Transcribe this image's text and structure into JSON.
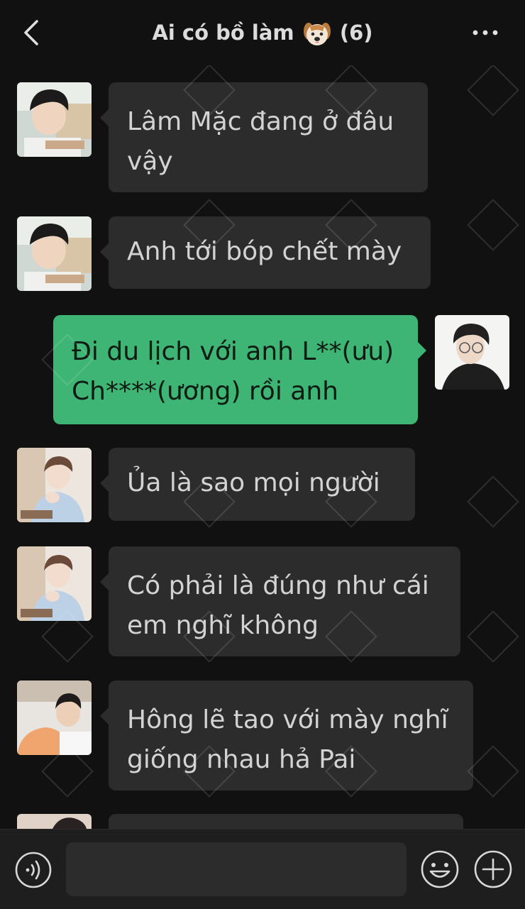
{
  "header": {
    "back_icon": "chevron-left-icon",
    "title_text": "Ai có bồ làm",
    "title_emoji": "dog-face-emoji",
    "member_count": "(6)",
    "more_icon": "ellipsis-icon"
  },
  "messages": [
    {
      "direction": "incoming",
      "avatar": "avatar-boy-reading",
      "text_lines": [
        "Lâm Mặc đang ở đâu",
        "vậy"
      ]
    },
    {
      "direction": "incoming",
      "avatar": "avatar-boy-reading",
      "text_lines": [
        "Anh tới bóp chết mày"
      ]
    },
    {
      "direction": "outgoing",
      "avatar": "avatar-boy-glasses",
      "text_lines": [
        "Đi du lịch với anh L**(ưu)",
        "Ch****(ương) rồi anh"
      ]
    },
    {
      "direction": "incoming",
      "avatar": "avatar-boy-blue-shirt",
      "text_lines": [
        "Ủa là sao mọi người"
      ]
    },
    {
      "direction": "incoming",
      "avatar": "avatar-boy-blue-shirt",
      "text_lines": [
        "Có phải là đúng như cái",
        "em nghĩ không"
      ]
    },
    {
      "direction": "incoming",
      "avatar": "avatar-boy-orange-shirt",
      "text_lines": [
        "Hông lẽ tao với mày nghĩ",
        "giống nhau hả Pai"
      ]
    }
  ],
  "input_bar": {
    "voice_icon": "voice-icon",
    "text_value": "",
    "emoji_icon": "smiley-icon",
    "plus_icon": "plus-icon"
  },
  "colors": {
    "background": "#111111",
    "bubble_incoming": "#2c2c2c",
    "bubble_outgoing": "#3eb575",
    "input_bar": "#1e1e1e"
  }
}
